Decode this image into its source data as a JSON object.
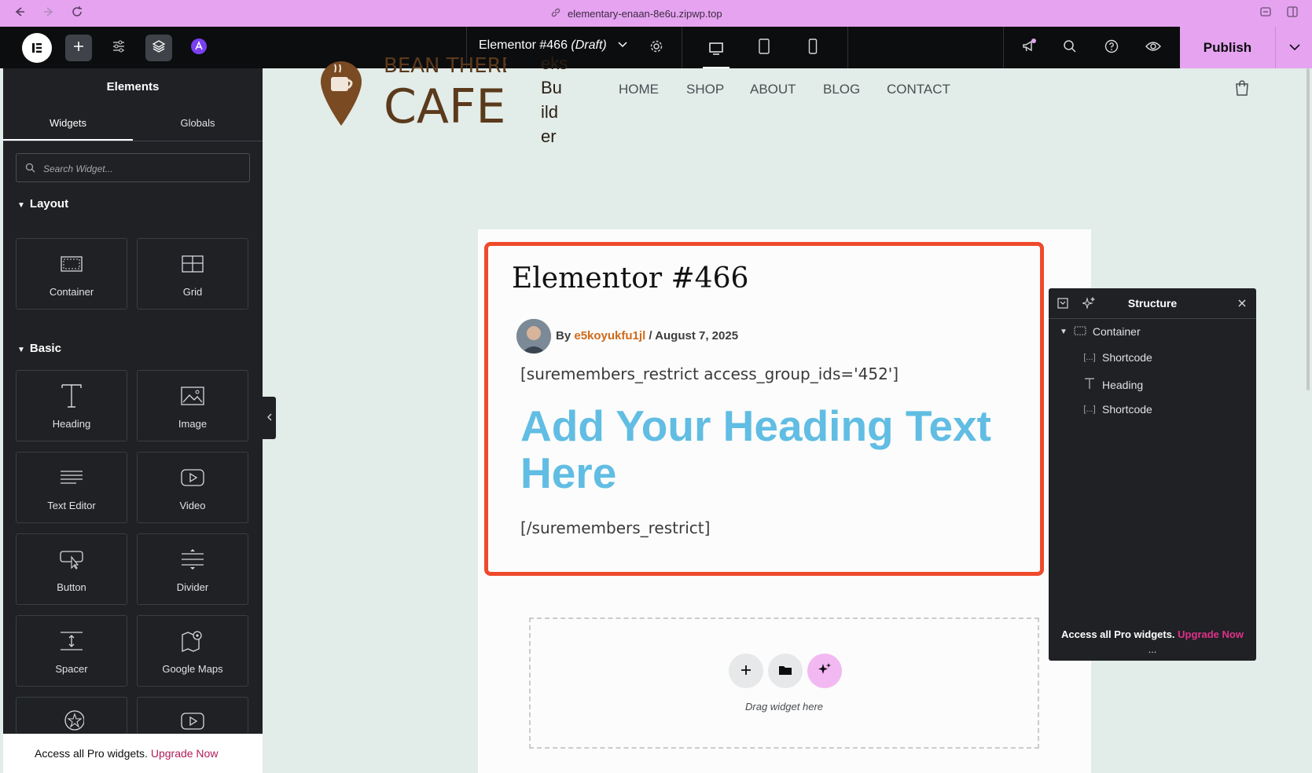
{
  "browser": {
    "url": "elementary-enaan-8e6u.zipwp.top"
  },
  "topbar": {
    "doc_title": "Elementor #466",
    "doc_status": "(Draft)",
    "publish_label": "Publish"
  },
  "panel": {
    "title": "Elements",
    "tabs": [
      "Widgets",
      "Globals"
    ],
    "search_placeholder": "Search Widget...",
    "categories": {
      "layout": "Layout",
      "basic": "Basic"
    },
    "widgets": {
      "container": "Container",
      "grid": "Grid",
      "heading": "Heading",
      "image": "Image",
      "text_editor": "Text Editor",
      "video": "Video",
      "button": "Button",
      "divider": "Divider",
      "spacer": "Spacer",
      "google_maps": "Google Maps"
    },
    "pro_text": "Access all Pro widgets.",
    "pro_link": "Upgrade Now"
  },
  "site": {
    "logo_text": "CAFE",
    "logo_top_text": "BEAN THERE",
    "builder_text": [
      "eks",
      "Bu",
      "ild",
      "er"
    ],
    "nav": [
      "HOME",
      "SHOP",
      "ABOUT",
      "BLOG",
      "CONTACT"
    ]
  },
  "post": {
    "title": "Elementor #466",
    "by": "By",
    "author": "e5koyukfu1jl",
    "date": "/ August 7, 2025",
    "shortcode_open": "[suremembers_restrict access_group_ids='452']",
    "heading": "Add Your Heading Text Here",
    "shortcode_close": "[/suremembers_restrict]"
  },
  "dropzone": {
    "text": "Drag widget here"
  },
  "structure": {
    "title": "Structure",
    "items": [
      "Container",
      "Shortcode",
      "Heading",
      "Shortcode"
    ],
    "pro_text": "Access all Pro widgets.",
    "pro_link": "Upgrade Now",
    "grip": "..."
  },
  "colors": {
    "accent": "#e5a3f0",
    "selection_border": "#ee4a2b",
    "heading_blue": "#61bde3",
    "author_orange": "#d06a1b",
    "upgrade_link": "#b01b57",
    "editor_dark": "#1f2124",
    "canvas_bg": "#e2ece8"
  }
}
